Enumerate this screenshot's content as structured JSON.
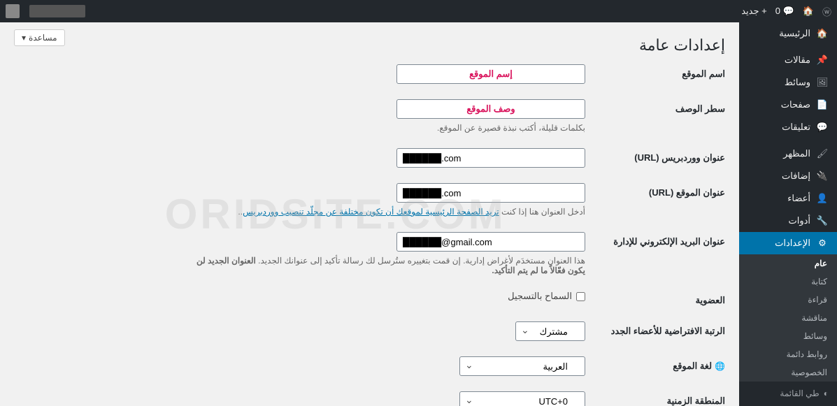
{
  "adminbar": {
    "comments_count": "0",
    "new_label": "جديد"
  },
  "sidebar": {
    "items": [
      {
        "icon": "🏠",
        "label": "الرئيسية"
      },
      {
        "icon": "📌",
        "label": "مقالات"
      },
      {
        "icon": "🖼",
        "label": "وسائط"
      },
      {
        "icon": "📄",
        "label": "صفحات"
      },
      {
        "icon": "💬",
        "label": "تعليقات"
      },
      {
        "icon": "🖌",
        "label": "المظهر"
      },
      {
        "icon": "🔌",
        "label": "إضافات"
      },
      {
        "icon": "👤",
        "label": "أعضاء"
      },
      {
        "icon": "🔧",
        "label": "أدوات"
      },
      {
        "icon": "⚙",
        "label": "الإعدادات"
      }
    ],
    "sub": [
      "عام",
      "كتابة",
      "قراءة",
      "مناقشة",
      "وسائط",
      "روابط دائمة",
      "الخصوصية"
    ],
    "collapse": "طي القائمة"
  },
  "page": {
    "title": "إعدادات عامة",
    "help": "مساعدة"
  },
  "fields": {
    "site_title_label": "اسم الموقع",
    "site_title_value": "إسم الموقع",
    "tagline_label": "سطر الوصف",
    "tagline_value": "وصف الموقع",
    "tagline_desc": "بكلمات قليلة، أكتب نبذة قصيرة عن الموقع.",
    "wp_url_label": "عنوان ووردبريس (URL)",
    "wp_url_value": ".com",
    "site_url_label": "عنوان الموقع (URL)",
    "site_url_value": ".com",
    "site_url_desc_pre": "أدخل العنوان هنا إذا كنت ",
    "site_url_desc_link": "تريد الصفحة الرئيسية لموقعك أن تكون مختلفة عن مجلّد تنصيب ووردبريس",
    "site_url_desc_post": "..",
    "admin_email_label": "عنوان البريد الإلكتروني للإدارة",
    "admin_email_value": "@gmail.com",
    "admin_email_desc": "هذا العنوان مستخدَم لأغراض إدارية. إن قمت بتغييره ستُرسل لك رسالة تأكيد إلى عنوانك الجديد. ",
    "admin_email_desc_bold": "العنوان الجديد لن يكون فعّالاً ما لم يتم التأكيد.",
    "membership_label": "العضوية",
    "membership_checkbox": "السماح بالتسجيل",
    "default_role_label": "الرتبة الافتراضية للأعضاء الجدد",
    "default_role_value": "مشترك",
    "lang_label": "لغة الموقع",
    "lang_value": "العربية",
    "timezone_label": "المنطقة الزمنية",
    "timezone_value": "UTC+0"
  },
  "watermark": "ORIDSITE.COM"
}
